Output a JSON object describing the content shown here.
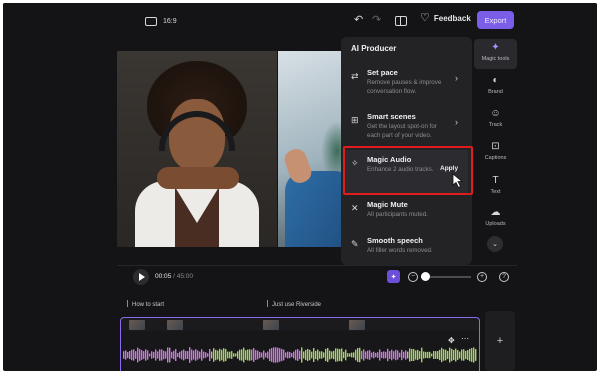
{
  "topbar": {
    "aspect_ratio": "16:9",
    "feedback_label": "Feedback",
    "export_label": "Export"
  },
  "ai_producer": {
    "title": "AI Producer",
    "items": [
      {
        "icon": "set-pace-icon",
        "title": "Set pace",
        "desc": "Remove pauses & improve conversation flow.",
        "has_chevron": true
      },
      {
        "icon": "smart-scenes-icon",
        "title": "Smart scenes",
        "desc": "Get the layout spot-on for each part of your video.",
        "has_chevron": true
      },
      {
        "icon": "magic-audio-icon",
        "title": "Magic Audio",
        "desc": "Enhance 2 audio tracks.",
        "action": "Apply",
        "active": true
      },
      {
        "icon": "magic-mute-icon",
        "title": "Magic Mute",
        "desc": "All participants muted."
      },
      {
        "icon": "smooth-speech-icon",
        "title": "Smooth speech",
        "desc": "All filler words removed."
      }
    ]
  },
  "rail": {
    "items": [
      {
        "icon": "magic-wand-icon",
        "label": "Magic tools",
        "active": true
      },
      {
        "icon": "palette-icon",
        "label": "Brand"
      },
      {
        "icon": "person-icon",
        "label": "Track"
      },
      {
        "icon": "captions-icon",
        "label": "Captions"
      },
      {
        "icon": "text-icon",
        "label": "Text"
      },
      {
        "icon": "upload-icon",
        "label": "Uploads"
      }
    ]
  },
  "playback": {
    "current_time": "00:05",
    "separator": " / ",
    "total_time": "45:00",
    "zoom_level": 0.08
  },
  "timeline": {
    "markers": [
      "How to start",
      "Just use Riverside"
    ]
  },
  "colors": {
    "accent": "#7b5de8",
    "highlight_box": "#e01c1c",
    "wave_pink": "#c77dd6",
    "wave_green": "#a8d36b"
  }
}
